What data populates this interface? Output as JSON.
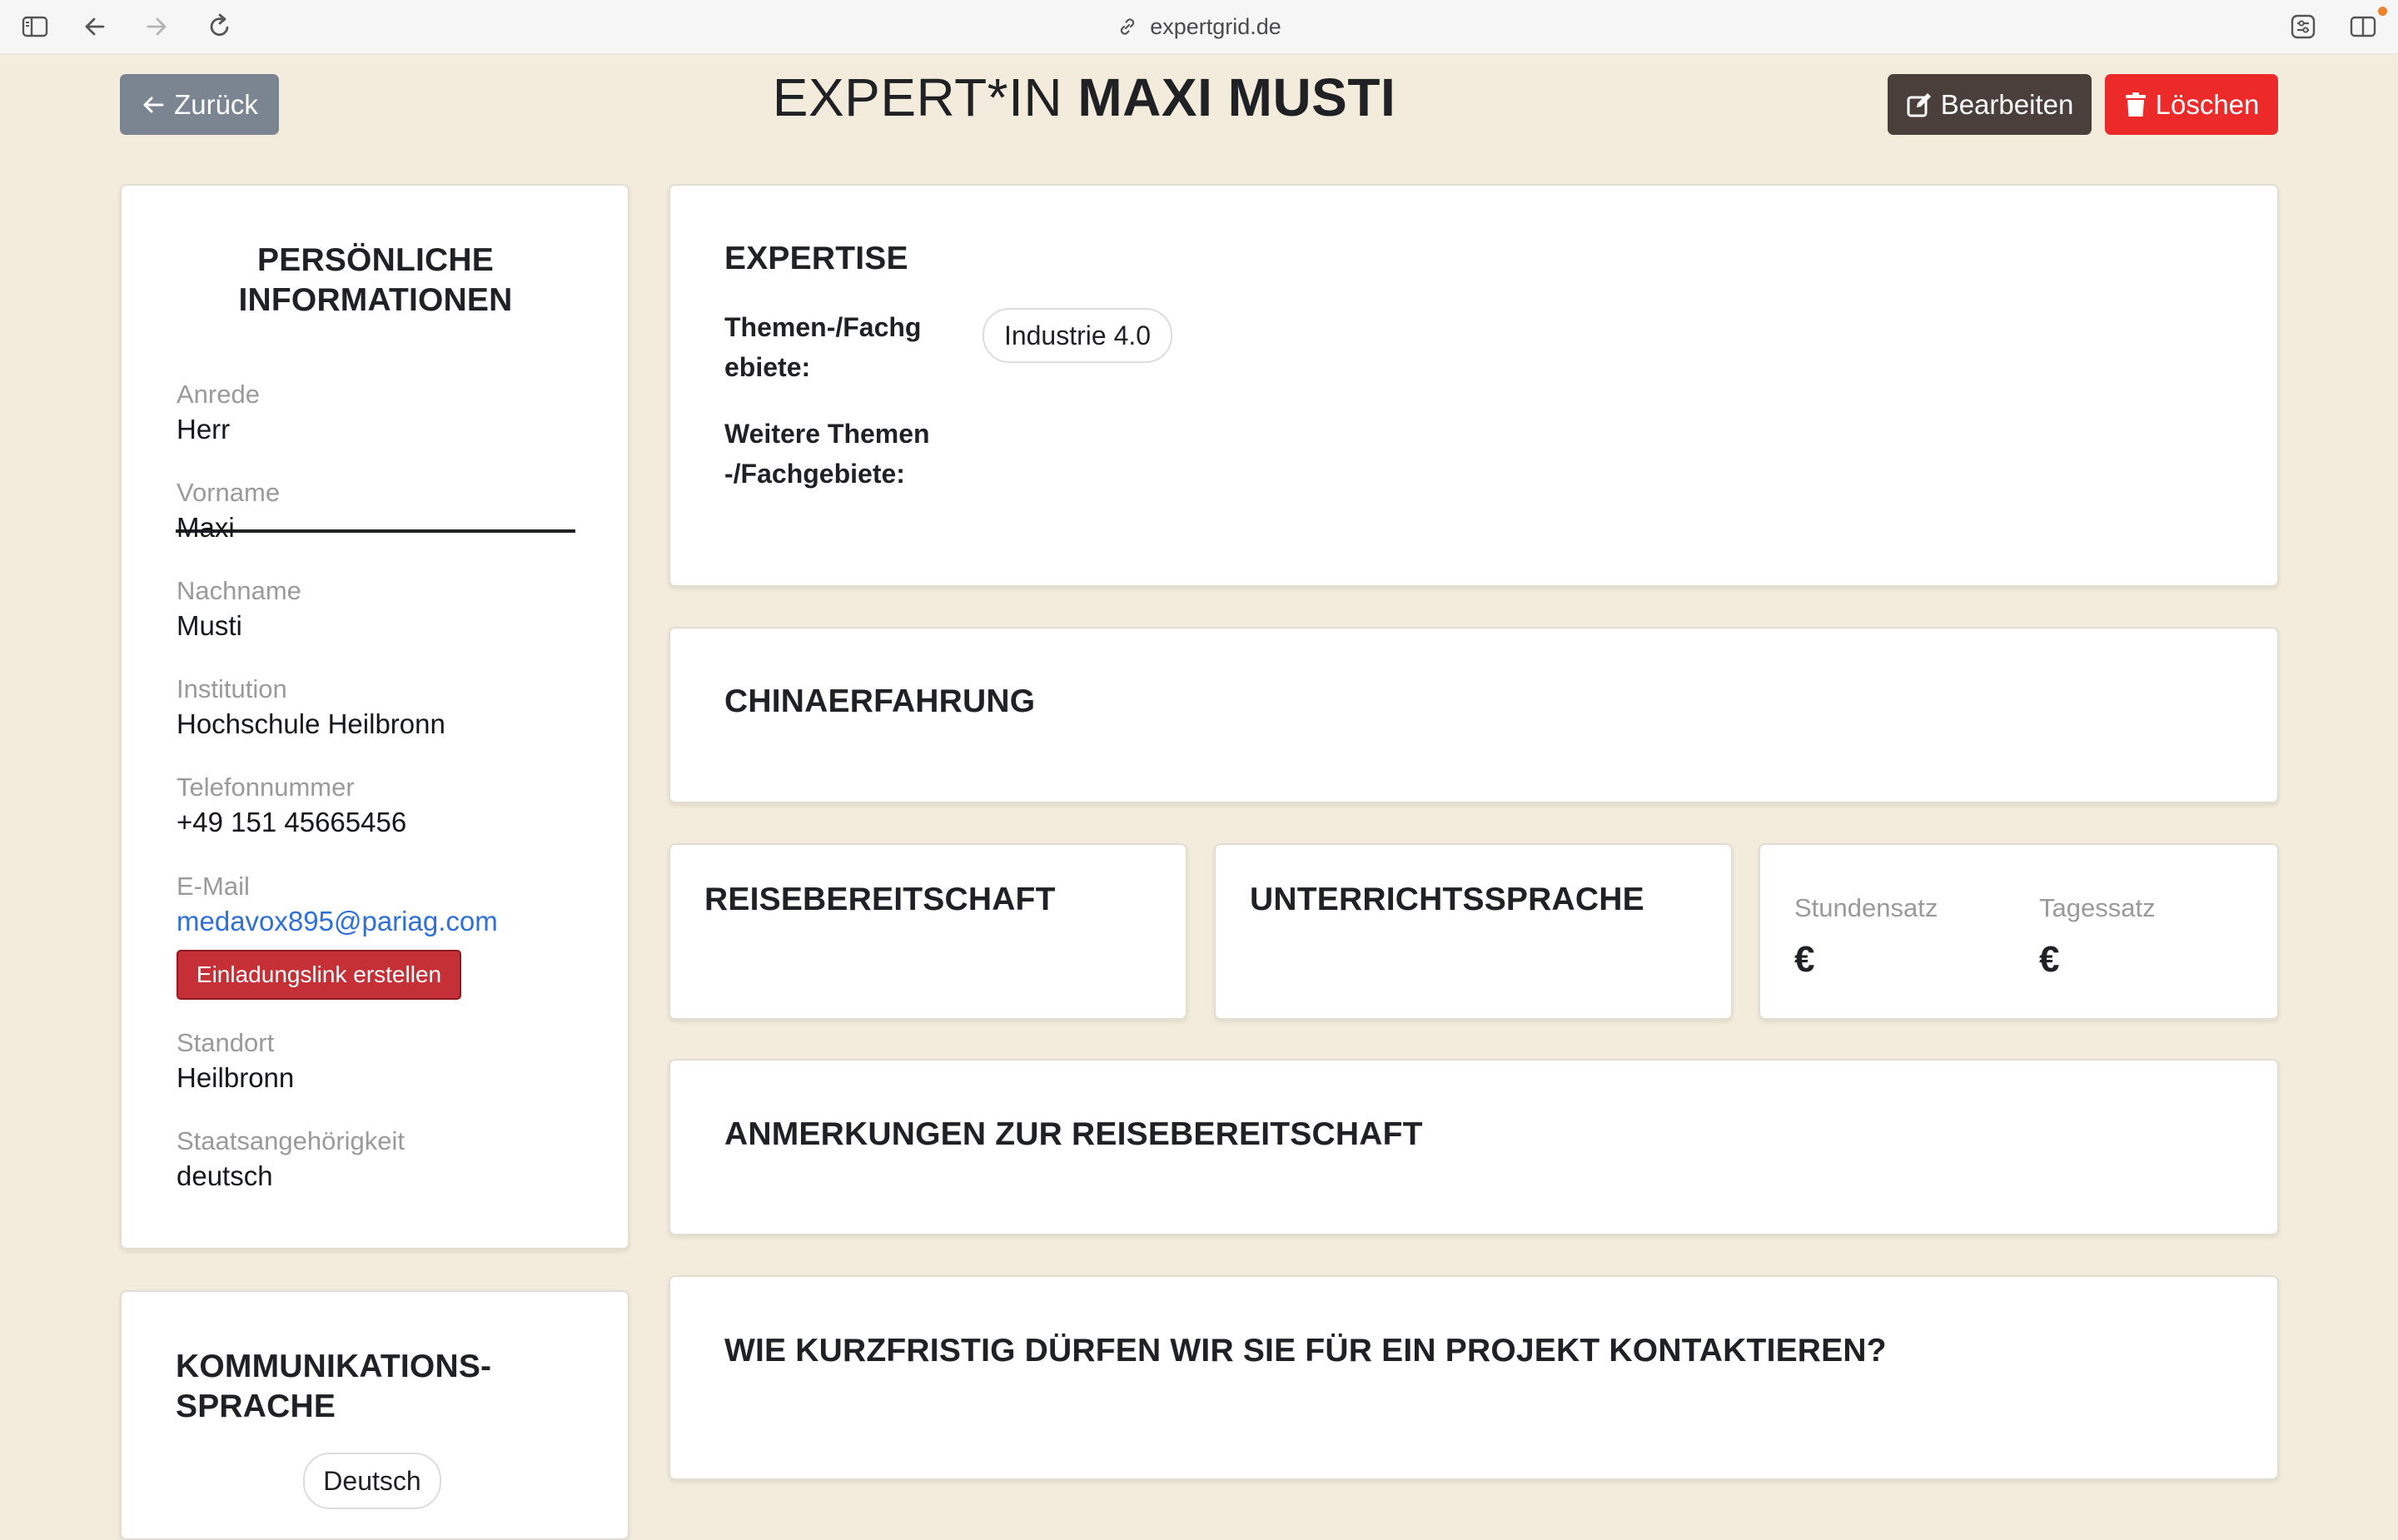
{
  "browser": {
    "url": "expertgrid.de",
    "sidebar_icon": "sidebar-icon",
    "back_icon": "arrow-left-icon",
    "forward_icon": "arrow-right-icon",
    "reload_icon": "reload-icon",
    "link_icon": "link-icon",
    "extension_icon": "extension-icon",
    "split_view_icon": "split-view-icon",
    "notification_dot_color": "#f0812a"
  },
  "header": {
    "back_label": "Zurück",
    "title_prefix": "EXPERT*IN",
    "title_name": "MAXI MUSTI",
    "edit_label": "Bearbeiten",
    "delete_label": "Löschen",
    "colors": {
      "back": "#7b8591",
      "edit": "#4a3f3b",
      "delete": "#ec2a2a"
    }
  },
  "personal": {
    "heading_line1": "PERSÖNLICHE",
    "heading_line2": "INFORMATIONEN",
    "fields": [
      {
        "label": "Anrede",
        "value": "Herr"
      },
      {
        "label": "Vorname",
        "value": "Maxi"
      },
      {
        "label": "Nachname",
        "value": "Musti"
      },
      {
        "label": "Institution",
        "value": "Hochschule Heilbronn"
      },
      {
        "label": "Telefonnummer",
        "value": "+49 151 45665456"
      },
      {
        "label": "E-Mail",
        "value": "medavox895@pariag.com"
      },
      {
        "label": "Standort",
        "value": "Heilbronn"
      },
      {
        "label": "Staatsangehörigkeit",
        "value": "deutsch"
      }
    ],
    "invite_button": "Einladungslink erstellen"
  },
  "communication": {
    "heading_line1": "KOMMUNIKATIONS-",
    "heading_line2": "SPRACHE",
    "languages": [
      "Deutsch"
    ]
  },
  "expertise": {
    "heading": "EXPERTISE",
    "topics_label": "Themen-/Fachgebiete:",
    "topics": [
      "Industrie 4.0"
    ],
    "more_topics_label": "Weitere Themen-/Fachgebiete:"
  },
  "china": {
    "heading": "CHINAERFAHRUNG"
  },
  "travel": {
    "heading": "REISEBEREITSCHAFT"
  },
  "teaching_language": {
    "heading": "UNTERRICHTSSPRACHE"
  },
  "rates": {
    "hourly_label": "Stundensatz",
    "hourly_value": "€",
    "daily_label": "Tagessatz",
    "daily_value": "€"
  },
  "travel_notes": {
    "heading": "ANMERKUNGEN ZUR REISEBEREITSCHAFT"
  },
  "short_notice": {
    "heading": "WIE KURZFRISTIG DÜRFEN WIR SIE FÜR EIN PROJEKT KONTAKTIEREN?"
  }
}
